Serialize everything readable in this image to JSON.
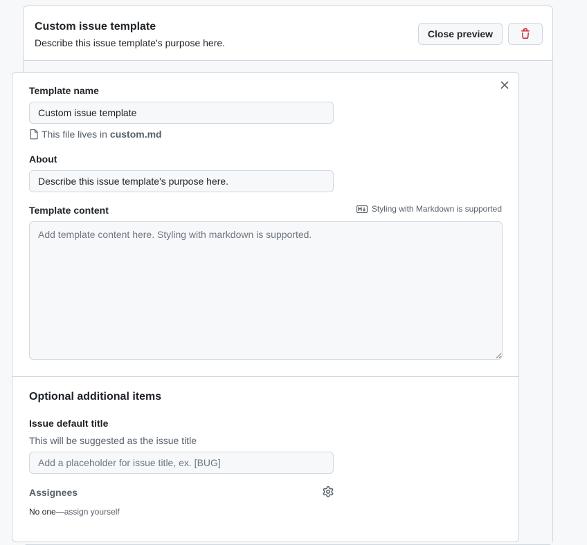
{
  "header": {
    "title": "Custom issue template",
    "description": "Describe this issue template's purpose here.",
    "close_preview_label": "Close preview",
    "trash_icon": "trash-icon"
  },
  "form": {
    "template_name": {
      "label": "Template name",
      "value": "Custom issue template",
      "file_hint_prefix": "This file lives in ",
      "file_name": "custom.md"
    },
    "about": {
      "label": "About",
      "value": "Describe this issue template's purpose here."
    },
    "template_content": {
      "label": "Template content",
      "markdown_note": "Styling with Markdown is supported",
      "placeholder": "Add template content here. Styling with markdown is supported.",
      "value": ""
    }
  },
  "optional": {
    "title": "Optional additional items",
    "issue_default_title": {
      "label": "Issue default title",
      "hint": "This will be suggested as the issue title",
      "placeholder": "Add a placeholder for issue title, ex. [BUG]"
    },
    "assignees": {
      "label": "Assignees",
      "none_text": "No one—",
      "assign_link": "assign yourself"
    }
  },
  "colors": {
    "danger": "#cf222e",
    "border": "#d0d7de",
    "muted_text": "#57606a",
    "input_bg": "#f6f8fa"
  }
}
